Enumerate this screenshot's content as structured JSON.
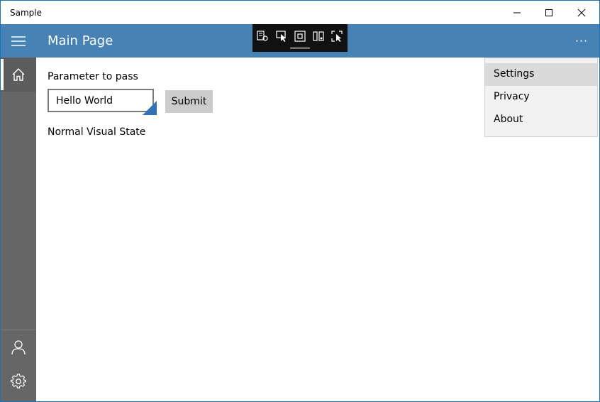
{
  "window": {
    "title": "Sample",
    "minimize_icon": "minimize-icon",
    "maximize_icon": "maximize-icon",
    "close_icon": "close-icon"
  },
  "header": {
    "title": "Main Page",
    "menu_icon": "hamburger-icon",
    "more_label": "···",
    "accent_color": "#4682b4"
  },
  "debug_toolbar": {
    "icons": [
      "live-visual-tree-icon",
      "select-element-icon",
      "display-layout-adorners-icon",
      "track-focus-icon",
      "hot-reload-icon"
    ]
  },
  "rail": {
    "items": [
      {
        "icon": "home-icon",
        "selected": true
      },
      {
        "icon": "user-icon",
        "selected": false
      },
      {
        "icon": "gear-icon",
        "selected": false
      }
    ],
    "color": "#666666"
  },
  "main": {
    "param_label": "Parameter to pass",
    "input_value": "Hello World",
    "submit_label": "Submit",
    "state_label": "Normal Visual State"
  },
  "menu": {
    "items": [
      {
        "label": "Settings",
        "highlighted": true
      },
      {
        "label": "Privacy",
        "highlighted": false
      },
      {
        "label": "About",
        "highlighted": false
      }
    ]
  }
}
